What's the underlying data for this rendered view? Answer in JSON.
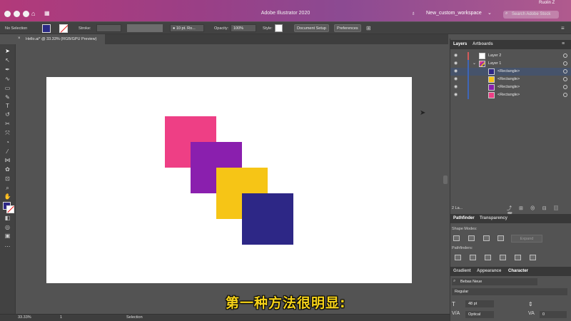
{
  "window": {
    "app_title": "Adobe Illustrator 2020",
    "workspace": "New_custom_workspace",
    "search_placeholder": "Search Adobe Stock",
    "menubar_user": "Ruolin Z"
  },
  "controlbar": {
    "selection": "No Selection",
    "stroke_label": "Stroke:",
    "brush": "10 pt. Ro...",
    "opacity_label": "Opacity:",
    "opacity_value": "100%",
    "style_label": "Style:",
    "doc_setup": "Document Setup",
    "preferences": "Preferences"
  },
  "document": {
    "tab_title": "Hello.ai* @ 33.33% (RGB/GPU Preview)",
    "tab_close": "×"
  },
  "colors": {
    "pink": "#ee3f85",
    "purple": "#8a1fae",
    "yellow": "#f6c516",
    "navy": "#2d2786",
    "accent": "#46536b"
  },
  "artwork": [
    {
      "name": "pink-rectangle",
      "color": "#ee3f85"
    },
    {
      "name": "purple-rectangle",
      "color": "#8a1fae"
    },
    {
      "name": "yellow-rectangle",
      "color": "#f6c516"
    },
    {
      "name": "navy-rectangle",
      "color": "#2d2786"
    }
  ],
  "layers_panel": {
    "tab_layers": "Layers",
    "tab_artboards": "Artboards",
    "rows": [
      {
        "label": "Layer 2"
      },
      {
        "label": "Layer 1"
      },
      {
        "label": "<Rectangle>"
      },
      {
        "label": "<Rectangle>"
      },
      {
        "label": "<Rectangle>"
      },
      {
        "label": "<Rectangle>"
      }
    ],
    "footer": "2 La..."
  },
  "pathfinder_panel": {
    "tab_pathfinder": "Pathfinder",
    "tab_transparency": "Transparency",
    "shape_modes": "Shape Modes:",
    "expand": "Expand",
    "pathfinders": "Pathfinders:"
  },
  "character_panel": {
    "tab_gradient": "Gradient",
    "tab_appearance": "Appearance",
    "tab_character": "Character",
    "font": "Bebas Neue",
    "style": "Regular",
    "size": "48 pt",
    "kerning": "Optical",
    "tracking": "0"
  },
  "statusbar": {
    "zoom": "33.33%",
    "artboard": "1",
    "tool": "Selection"
  },
  "subtitle": "第一种方法很明显:"
}
